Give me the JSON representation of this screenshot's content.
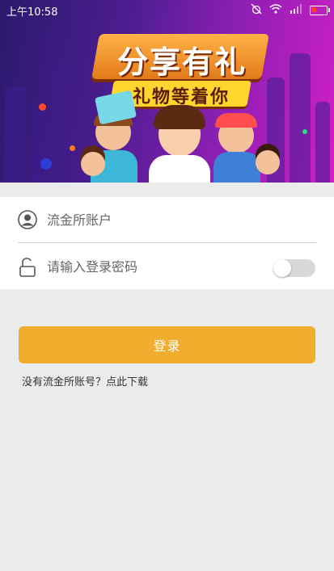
{
  "status_bar": {
    "time": "上午10:58"
  },
  "banner": {
    "title": "分享有礼",
    "subtitle": "礼物等着你"
  },
  "form": {
    "account_placeholder": "流金所账户",
    "password_placeholder": "请输入登录密码",
    "show_password_toggle_on": false
  },
  "login_button_label": "登录",
  "download_link_text": "没有流金所账号？点此下载",
  "colors": {
    "accent": "#f0ad2e",
    "page_background": "#ebebeb"
  }
}
